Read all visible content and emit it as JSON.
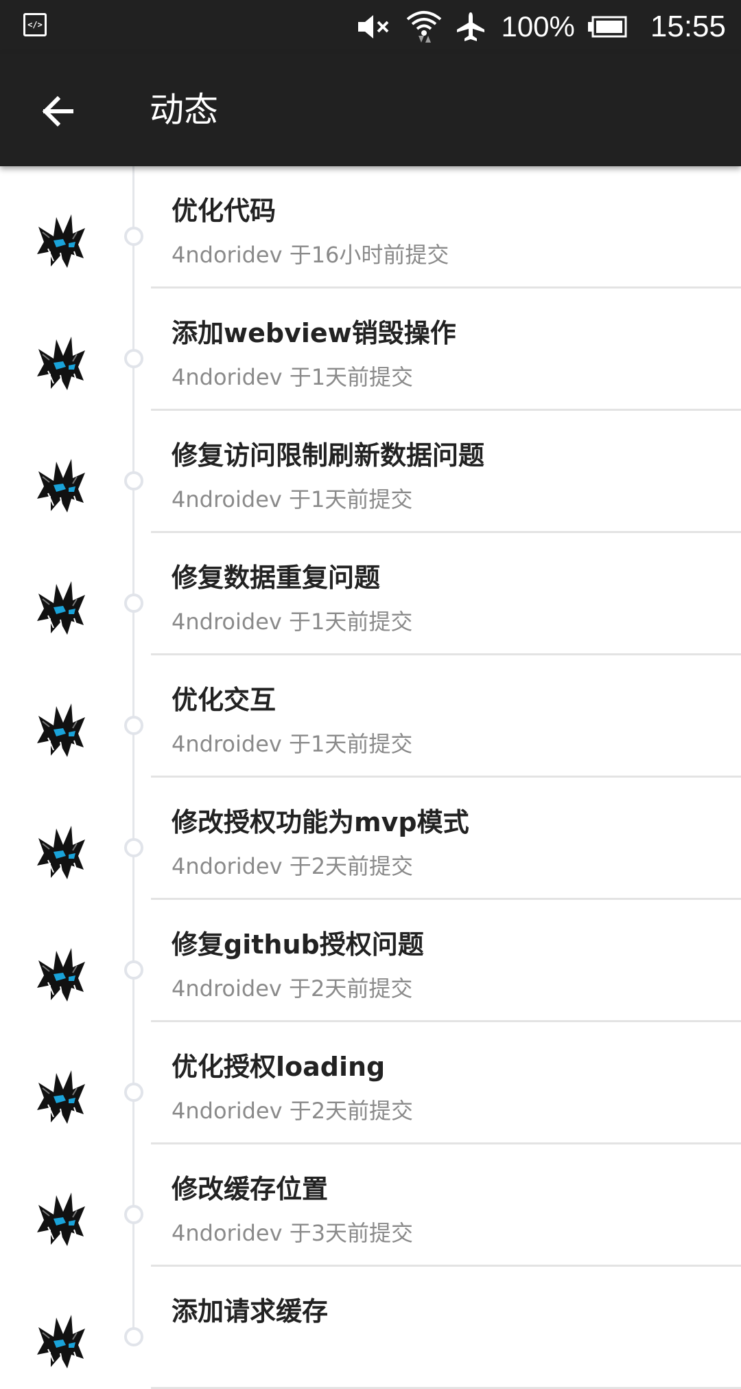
{
  "status_bar": {
    "battery_percent": "100%",
    "time": "15:55",
    "icons": [
      "developer-mode-icon",
      "volume-muted-icon",
      "wifi-icon",
      "airplane-mode-icon",
      "battery-icon"
    ]
  },
  "app_bar": {
    "title": "动态",
    "back_icon": "arrow-back-icon"
  },
  "commits": [
    {
      "title": "优化代码",
      "meta": "4ndoridev 于16小时前提交"
    },
    {
      "title": "添加webview销毁操作",
      "meta": "4ndoridev 于1天前提交"
    },
    {
      "title": "修复访问限制刷新数据问题",
      "meta": "4ndroidev 于1天前提交"
    },
    {
      "title": "修复数据重复问题",
      "meta": "4ndroidev 于1天前提交"
    },
    {
      "title": "优化交互",
      "meta": "4ndroidev 于1天前提交"
    },
    {
      "title": "修改授权功能为mvp模式",
      "meta": "4ndoridev 于2天前提交"
    },
    {
      "title": "修复github授权问题",
      "meta": "4ndroidev 于2天前提交"
    },
    {
      "title": "优化授权loading",
      "meta": "4ndoridev 于2天前提交"
    },
    {
      "title": "修改缓存位置",
      "meta": "4ndoridev 于3天前提交"
    },
    {
      "title": "添加请求缓存",
      "meta": ""
    }
  ],
  "colors": {
    "app_bar": "#212121",
    "title_text": "#222222",
    "meta_text": "#8a8a8a",
    "timeline": "#e4e6ea",
    "avatar_accent": "#1aa3d9"
  }
}
